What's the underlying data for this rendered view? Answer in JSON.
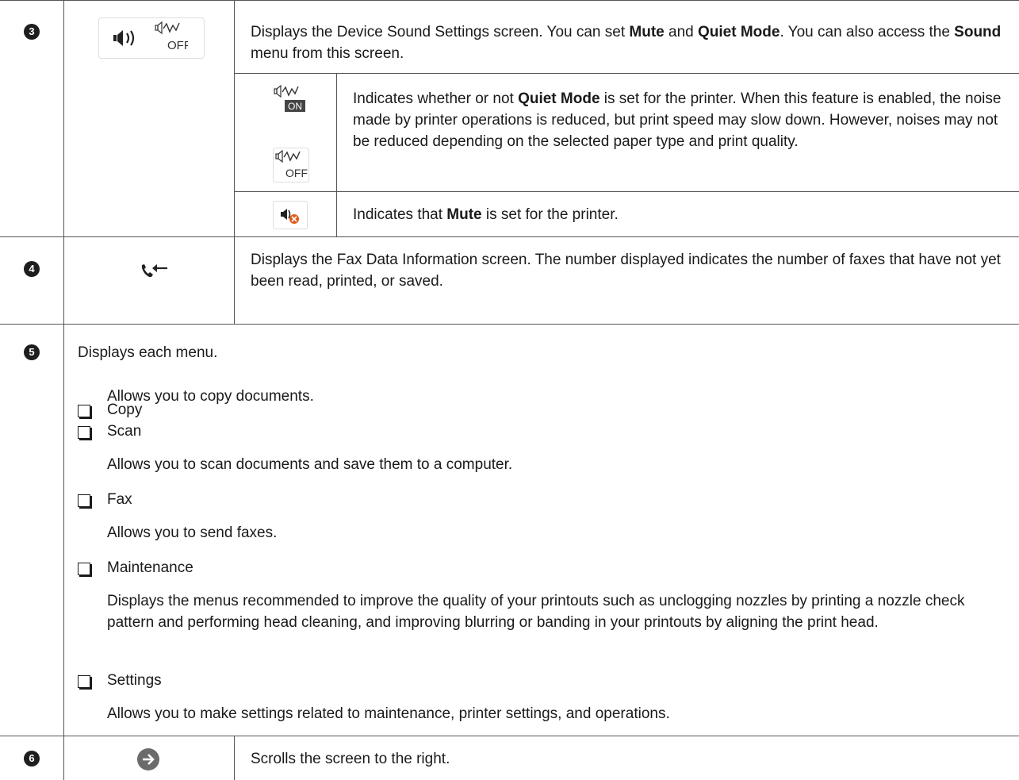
{
  "rows": [
    {
      "number": "3",
      "icon_names": [
        "speaker-icon",
        "quiet-mode-off-icon"
      ],
      "description_parts": [
        {
          "text": "Displays the Device Sound Settings screen. You can set ",
          "bold": false
        },
        {
          "text": "Mute",
          "bold": true
        },
        {
          "text": " and ",
          "bold": false
        },
        {
          "text": "Quiet Mode",
          "bold": true
        },
        {
          "text": ". You can also access the ",
          "bold": false
        },
        {
          "text": "Sound",
          "bold": true
        },
        {
          "text": " menu from this screen.",
          "bold": false
        }
      ],
      "subrows": [
        {
          "icon_names": [
            "quiet-mode-on-icon",
            "quiet-mode-off-icon"
          ],
          "icon_labels": [
            "ON",
            "OFF"
          ],
          "description_parts": [
            {
              "text": "Indicates whether or not ",
              "bold": false
            },
            {
              "text": "Quiet Mode",
              "bold": true
            },
            {
              "text": " is set for the printer. When this feature is enabled, the noise made by printer operations is reduced, but print speed may slow down. However, noises may not be reduced depending on the selected paper type and print quality.",
              "bold": false
            }
          ]
        },
        {
          "icon_names": [
            "mute-icon"
          ],
          "description_parts": [
            {
              "text": "Indicates that ",
              "bold": false
            },
            {
              "text": "Mute",
              "bold": true
            },
            {
              "text": " is set for the printer.",
              "bold": false
            }
          ]
        }
      ]
    },
    {
      "number": "4",
      "icon_names": [
        "fax-data-icon"
      ],
      "description": "Displays the Fax Data Information screen. The number displayed indicates the number of faxes that have not yet been read, printed, or saved."
    },
    {
      "number": "5",
      "intro": "Displays each menu.",
      "items": [
        {
          "label": "Copy",
          "desc": "Allows you to copy documents."
        },
        {
          "label": "Scan",
          "desc": "Allows you to scan documents and save them to a computer."
        },
        {
          "label": "Fax",
          "desc": "Allows you to send faxes."
        },
        {
          "label": "Maintenance",
          "desc": "Displays the menus recommended to improve the quality of your printouts such as unclogging nozzles by printing a nozzle check pattern and performing head cleaning, and improving blurring or banding in your printouts by aligning the print head."
        },
        {
          "label": "Settings",
          "desc": "Allows you to make settings related to maintenance, printer settings, and operations."
        }
      ]
    },
    {
      "number": "6",
      "icon_names": [
        "arrow-right-icon"
      ],
      "description": "Scrolls the screen to the right."
    }
  ],
  "colors": {
    "rule": "#555555",
    "badge": "#1e1e1e",
    "arrow_circle": "#6b6b6b",
    "mute_x": "#e05a1c"
  }
}
